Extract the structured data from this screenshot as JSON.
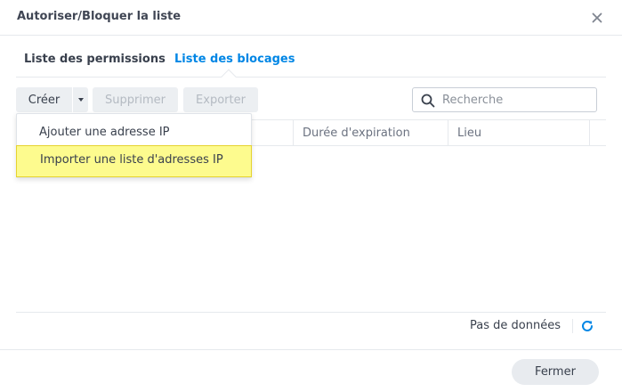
{
  "dialog": {
    "title": "Autoriser/Bloquer la liste",
    "close_icon": "close-icon"
  },
  "tabs": [
    {
      "label": "Liste des permissions",
      "active": false
    },
    {
      "label": "Liste des blocages",
      "active": true
    }
  ],
  "toolbar": {
    "create_label": "Créer",
    "delete_label": "Supprimer",
    "export_label": "Exporter",
    "search_placeholder": "Recherche"
  },
  "create_menu": {
    "items": [
      {
        "label": "Ajouter une adresse IP"
      },
      {
        "label": "Importer une liste d'adresses IP",
        "highlighted": true
      }
    ]
  },
  "table": {
    "columns": [
      "",
      "Durée d'expiration",
      "Lieu",
      ""
    ],
    "rows": []
  },
  "footer": {
    "status_text": "Pas de données",
    "refresh_icon": "refresh-icon"
  },
  "actions": {
    "close_label": "Fermer"
  },
  "colors": {
    "accent": "#0086e5",
    "highlight": "#fdfb8e"
  }
}
